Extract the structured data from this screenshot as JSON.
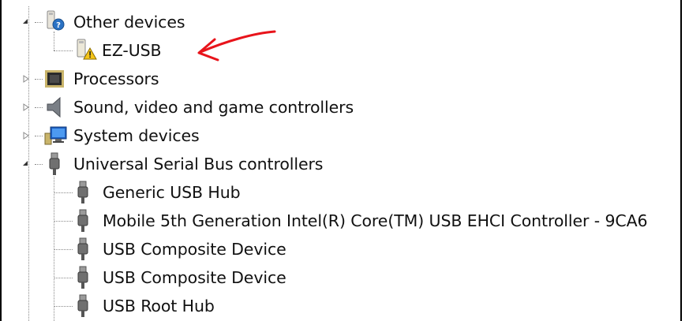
{
  "tree": {
    "other_devices": {
      "label": "Other devices",
      "icon": "unknown-device-icon",
      "expanded": true
    },
    "ez_usb": {
      "label": "EZ-USB",
      "icon": "warning-device-icon"
    },
    "processors": {
      "label": "Processors",
      "icon": "processor-chip-icon",
      "expanded": false
    },
    "sound": {
      "label": "Sound, video and game controllers",
      "icon": "speaker-icon",
      "expanded": false
    },
    "system": {
      "label": "System devices",
      "icon": "system-computer-icon",
      "expanded": false
    },
    "usb": {
      "label": "Universal Serial Bus controllers",
      "icon": "usb-plug-icon",
      "expanded": true,
      "children": [
        {
          "label": "Generic USB Hub",
          "icon": "usb-plug-icon"
        },
        {
          "label": "Mobile 5th Generation Intel(R) Core(TM) USB EHCI Controller - 9CA6",
          "icon": "usb-plug-icon"
        },
        {
          "label": "USB Composite Device",
          "icon": "usb-plug-icon"
        },
        {
          "label": "USB Composite Device",
          "icon": "usb-plug-icon"
        },
        {
          "label": "USB Root Hub",
          "icon": "usb-plug-icon"
        }
      ]
    }
  },
  "annotation": {
    "type": "red-hand-drawn-arrow",
    "color": "#e8141b"
  }
}
